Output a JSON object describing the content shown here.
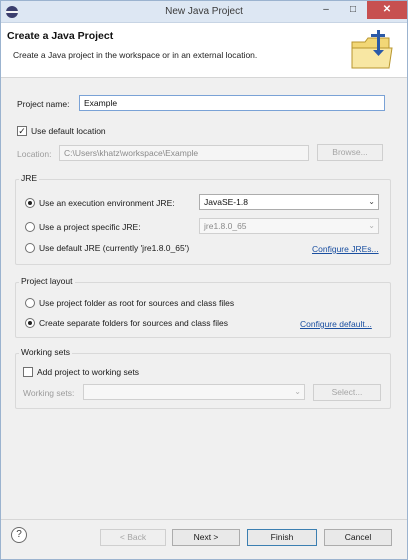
{
  "window": {
    "title": "New Java Project",
    "controls": {
      "minimize": "–",
      "maximize": "□",
      "close": "✕"
    }
  },
  "header": {
    "title": "Create a Java Project",
    "description": "Create a Java project in the workspace or in an external location."
  },
  "form": {
    "project_name_label": "Project name:",
    "project_name_value": "Example",
    "use_default_location_label": "Use default location",
    "use_default_location_checked": true,
    "location_label": "Location:",
    "location_value": "C:\\Users\\khatz\\workspace\\Example",
    "browse_label": "Browse..."
  },
  "jre": {
    "group_title": "JRE",
    "option_env_label": "Use an execution environment JRE:",
    "option_env_value": "JavaSE-1.8",
    "option_specific_label": "Use a project specific JRE:",
    "option_specific_value": "jre1.8.0_65",
    "option_default_label": "Use default JRE (currently 'jre1.8.0_65')",
    "configure_link": "Configure JREs...",
    "selected": "execution environment"
  },
  "layout": {
    "group_title": "Project layout",
    "option_root_label": "Use project folder as root for sources and class files",
    "option_separate_label": "Create separate folders for sources and class files",
    "configure_link": "Configure default...",
    "selected": "separate folders"
  },
  "working_sets": {
    "group_title": "Working sets",
    "add_label": "Add project to working sets",
    "add_checked": false,
    "sets_label": "Working sets:",
    "select_button": "Select..."
  },
  "footer": {
    "help": "?",
    "back": "< Back",
    "next": "Next >",
    "finish": "Finish",
    "cancel": "Cancel"
  }
}
